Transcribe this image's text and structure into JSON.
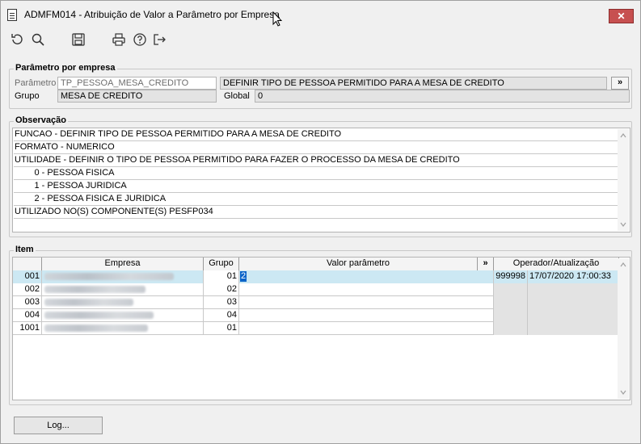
{
  "window": {
    "title": "ADMFM014 - Atribuição de Valor a Parâmetro por Empresa",
    "close_symbol": "✕"
  },
  "toolbar": {
    "icons": [
      "refresh-icon",
      "search-icon",
      "save-icon",
      "print-icon",
      "help-icon",
      "exit-icon"
    ]
  },
  "parametro_group": {
    "legend": "Parâmetro por empresa",
    "parametro_label": "Parâmetro",
    "parametro_value": "TP_PESSOA_MESA_CREDITO",
    "parametro_desc": "DEFINIR TIPO DE PESSOA PERMITIDO PARA A MESA DE CREDITO",
    "expand_label": "»",
    "grupo_label": "Grupo",
    "grupo_value": "MESA DE CREDITO",
    "global_label": "Global",
    "global_value": "0"
  },
  "observacao_group": {
    "legend": "Observação",
    "lines": [
      "FUNCAO - DEFINIR TIPO DE PESSOA PERMITIDO PARA A MESA DE CREDITO",
      "FORMATO - NUMERICO",
      "UTILIDADE - DEFINIR O TIPO DE PESSOA PERMITIDO PARA FAZER O PROCESSO DA MESA DE CREDITO",
      "        0 - PESSOA FISICA",
      "        1 - PESSOA JURIDICA",
      "        2 - PESSOA FISICA E JURIDICA",
      "UTILIZADO NO(S) COMPONENTE(S) PESFP034"
    ]
  },
  "item_group": {
    "legend": "Item",
    "headers": {
      "empresa": "Empresa",
      "grupo": "Grupo",
      "valor": "Valor parâmetro",
      "expand": "»",
      "operador": "Operador/Atualização"
    },
    "rows": [
      {
        "code": "001",
        "grupo": "01",
        "valor": "2",
        "operador": "999998",
        "atualizacao": "17/07/2020 17:00:33"
      },
      {
        "code": "002",
        "grupo": "02",
        "valor": "",
        "operador": "",
        "atualizacao": ""
      },
      {
        "code": "003",
        "grupo": "03",
        "valor": "",
        "operador": "",
        "atualizacao": ""
      },
      {
        "code": "004",
        "grupo": "04",
        "valor": "",
        "operador": "",
        "atualizacao": ""
      },
      {
        "code": "1001",
        "grupo": "01",
        "valor": "",
        "operador": "",
        "atualizacao": ""
      }
    ]
  },
  "footer": {
    "log_label": "Log..."
  }
}
